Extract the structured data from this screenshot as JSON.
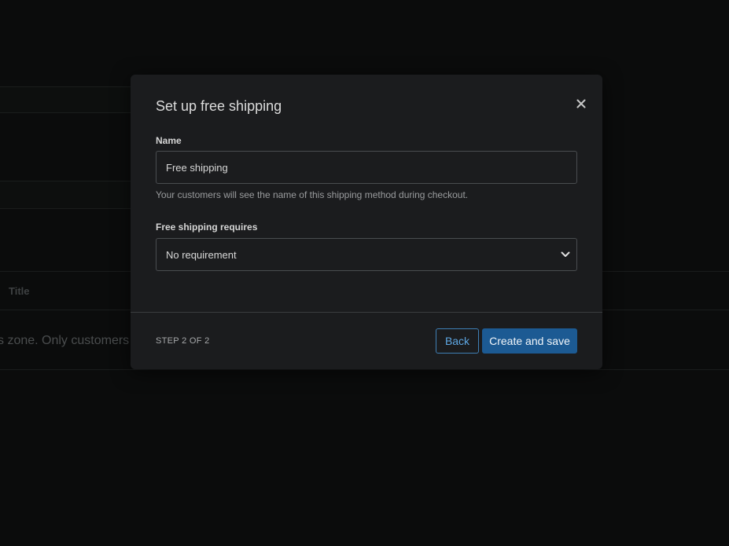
{
  "background": {
    "table_header_label": "Title",
    "table_row_text": "s zone. Only customers"
  },
  "modal": {
    "title": "Set up free shipping",
    "close_icon": "close-icon",
    "name_field": {
      "label": "Name",
      "value": "Free shipping",
      "help_text": "Your customers will see the name of this shipping method during checkout."
    },
    "requirement_field": {
      "label": "Free shipping requires",
      "selected_value": "No requirement",
      "icon": "chevron-down-icon"
    },
    "footer": {
      "step_indicator": "STEP 2 OF 2",
      "back_label": "Back",
      "primary_label": "Create and save"
    }
  },
  "colors": {
    "page_background": "#0b0c0c",
    "modal_background": "#1b1c1e",
    "primary_button": "#1c5a93",
    "secondary_button_accent": "#5ea7e3"
  }
}
